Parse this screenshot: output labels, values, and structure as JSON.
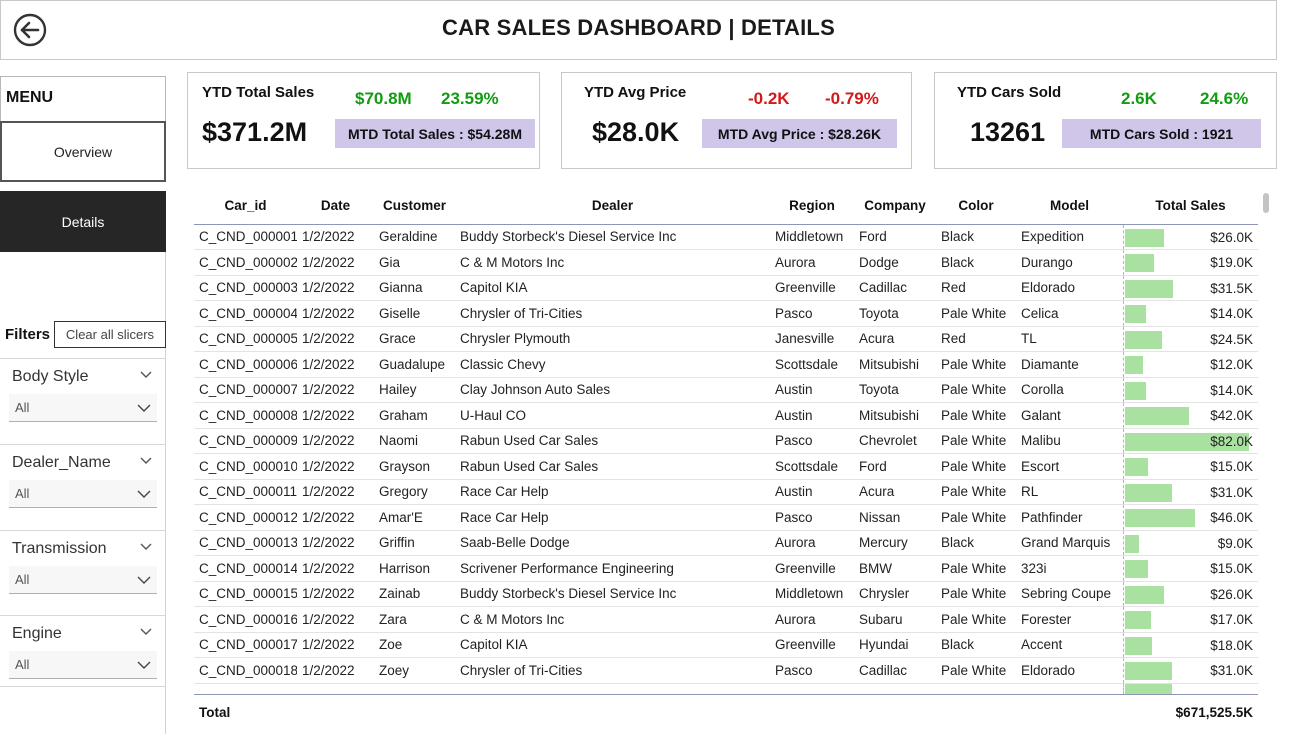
{
  "header": {
    "title": "CAR SALES DASHBOARD | DETAILS",
    "back_icon": "back-arrow-circle-icon"
  },
  "menu": {
    "label": "MENU",
    "items": [
      {
        "label": "Overview",
        "active": false
      },
      {
        "label": "Details",
        "active": true
      }
    ]
  },
  "filters": {
    "label": "Filters",
    "clear_label": "Clear all slicers",
    "slicers": [
      {
        "title": "Body Style",
        "value": "All"
      },
      {
        "title": "Dealer_Name",
        "value": "All"
      },
      {
        "title": "Transmission",
        "value": "All"
      },
      {
        "title": "Engine",
        "value": "All"
      }
    ]
  },
  "kpis": [
    {
      "title": "YTD Total Sales",
      "value": "$371.2M",
      "delta_abs": "$70.8M",
      "delta_pct": "23.59%",
      "trend": "up",
      "mtd": "MTD Total Sales : $54.28M"
    },
    {
      "title": "YTD Avg Price",
      "value": "$28.0K",
      "delta_abs": "-0.2K",
      "delta_pct": "-0.79%",
      "trend": "down",
      "mtd": "MTD Avg Price : $28.26K"
    },
    {
      "title": "YTD Cars Sold",
      "value": "13261",
      "delta_abs": "2.6K",
      "delta_pct": "24.6%",
      "trend": "up",
      "mtd": "MTD Cars Sold : 1921"
    }
  ],
  "colors": {
    "positive": "#119c11",
    "negative": "#d11a1a",
    "mtd_bg": "#cfc6ea",
    "bar": "#a9e2a0",
    "nav_active_bg": "#262626"
  },
  "table": {
    "columns": [
      "Car_id",
      "Date",
      "Customer",
      "Dealer",
      "Region",
      "Company",
      "Color",
      "Model",
      "Total Sales"
    ],
    "bar_max": 82.0,
    "rows": [
      {
        "car_id": "C_CND_000001",
        "date": "1/2/2022",
        "customer": "Geraldine",
        "dealer": "Buddy Storbeck's Diesel Service Inc",
        "region": "Middletown",
        "company": "Ford",
        "color": "Black",
        "model": "Expedition",
        "total_sales": "$26.0K",
        "sales_k": 26.0
      },
      {
        "car_id": "C_CND_000002",
        "date": "1/2/2022",
        "customer": "Gia",
        "dealer": "C & M Motors Inc",
        "region": "Aurora",
        "company": "Dodge",
        "color": "Black",
        "model": "Durango",
        "total_sales": "$19.0K",
        "sales_k": 19.0
      },
      {
        "car_id": "C_CND_000003",
        "date": "1/2/2022",
        "customer": "Gianna",
        "dealer": "Capitol KIA",
        "region": "Greenville",
        "company": "Cadillac",
        "color": "Red",
        "model": "Eldorado",
        "total_sales": "$31.5K",
        "sales_k": 31.5
      },
      {
        "car_id": "C_CND_000004",
        "date": "1/2/2022",
        "customer": "Giselle",
        "dealer": "Chrysler of Tri-Cities",
        "region": "Pasco",
        "company": "Toyota",
        "color": "Pale White",
        "model": "Celica",
        "total_sales": "$14.0K",
        "sales_k": 14.0
      },
      {
        "car_id": "C_CND_000005",
        "date": "1/2/2022",
        "customer": "Grace",
        "dealer": "Chrysler Plymouth",
        "region": "Janesville",
        "company": "Acura",
        "color": "Red",
        "model": "TL",
        "total_sales": "$24.5K",
        "sales_k": 24.5
      },
      {
        "car_id": "C_CND_000006",
        "date": "1/2/2022",
        "customer": "Guadalupe",
        "dealer": "Classic Chevy",
        "region": "Scottsdale",
        "company": "Mitsubishi",
        "color": "Pale White",
        "model": "Diamante",
        "total_sales": "$12.0K",
        "sales_k": 12.0
      },
      {
        "car_id": "C_CND_000007",
        "date": "1/2/2022",
        "customer": "Hailey",
        "dealer": "Clay Johnson Auto Sales",
        "region": "Austin",
        "company": "Toyota",
        "color": "Pale White",
        "model": "Corolla",
        "total_sales": "$14.0K",
        "sales_k": 14.0
      },
      {
        "car_id": "C_CND_000008",
        "date": "1/2/2022",
        "customer": "Graham",
        "dealer": "U-Haul CO",
        "region": "Austin",
        "company": "Mitsubishi",
        "color": "Pale White",
        "model": "Galant",
        "total_sales": "$42.0K",
        "sales_k": 42.0
      },
      {
        "car_id": "C_CND_000009",
        "date": "1/2/2022",
        "customer": "Naomi",
        "dealer": "Rabun Used Car Sales",
        "region": "Pasco",
        "company": "Chevrolet",
        "color": "Pale White",
        "model": "Malibu",
        "total_sales": "$82.0K",
        "sales_k": 82.0
      },
      {
        "car_id": "C_CND_000010",
        "date": "1/2/2022",
        "customer": "Grayson",
        "dealer": "Rabun Used Car Sales",
        "region": "Scottsdale",
        "company": "Ford",
        "color": "Pale White",
        "model": "Escort",
        "total_sales": "$15.0K",
        "sales_k": 15.0
      },
      {
        "car_id": "C_CND_000011",
        "date": "1/2/2022",
        "customer": "Gregory",
        "dealer": "Race Car Help",
        "region": "Austin",
        "company": "Acura",
        "color": "Pale White",
        "model": "RL",
        "total_sales": "$31.0K",
        "sales_k": 31.0
      },
      {
        "car_id": "C_CND_000012",
        "date": "1/2/2022",
        "customer": "Amar'E",
        "dealer": "Race Car Help",
        "region": "Pasco",
        "company": "Nissan",
        "color": "Pale White",
        "model": "Pathfinder",
        "total_sales": "$46.0K",
        "sales_k": 46.0
      },
      {
        "car_id": "C_CND_000013",
        "date": "1/2/2022",
        "customer": "Griffin",
        "dealer": "Saab-Belle Dodge",
        "region": "Aurora",
        "company": "Mercury",
        "color": "Black",
        "model": "Grand Marquis",
        "total_sales": "$9.0K",
        "sales_k": 9.0
      },
      {
        "car_id": "C_CND_000014",
        "date": "1/2/2022",
        "customer": "Harrison",
        "dealer": "Scrivener Performance Engineering",
        "region": "Greenville",
        "company": "BMW",
        "color": "Pale White",
        "model": "323i",
        "total_sales": "$15.0K",
        "sales_k": 15.0
      },
      {
        "car_id": "C_CND_000015",
        "date": "1/2/2022",
        "customer": "Zainab",
        "dealer": "Buddy Storbeck's Diesel Service Inc",
        "region": "Middletown",
        "company": "Chrysler",
        "color": "Pale White",
        "model": "Sebring Coupe",
        "total_sales": "$26.0K",
        "sales_k": 26.0
      },
      {
        "car_id": "C_CND_000016",
        "date": "1/2/2022",
        "customer": "Zara",
        "dealer": "C & M Motors Inc",
        "region": "Aurora",
        "company": "Subaru",
        "color": "Pale White",
        "model": "Forester",
        "total_sales": "$17.0K",
        "sales_k": 17.0
      },
      {
        "car_id": "C_CND_000017",
        "date": "1/2/2022",
        "customer": "Zoe",
        "dealer": "Capitol KIA",
        "region": "Greenville",
        "company": "Hyundai",
        "color": "Black",
        "model": "Accent",
        "total_sales": "$18.0K",
        "sales_k": 18.0
      },
      {
        "car_id": "C_CND_000018",
        "date": "1/2/2022",
        "customer": "Zoey",
        "dealer": "Chrysler of Tri-Cities",
        "region": "Pasco",
        "company": "Cadillac",
        "color": "Pale White",
        "model": "Eldorado",
        "total_sales": "$31.0K",
        "sales_k": 31.0
      }
    ],
    "partial_row_sales_k": 31.0,
    "total_label": "Total",
    "total_value": "$671,525.5K"
  }
}
